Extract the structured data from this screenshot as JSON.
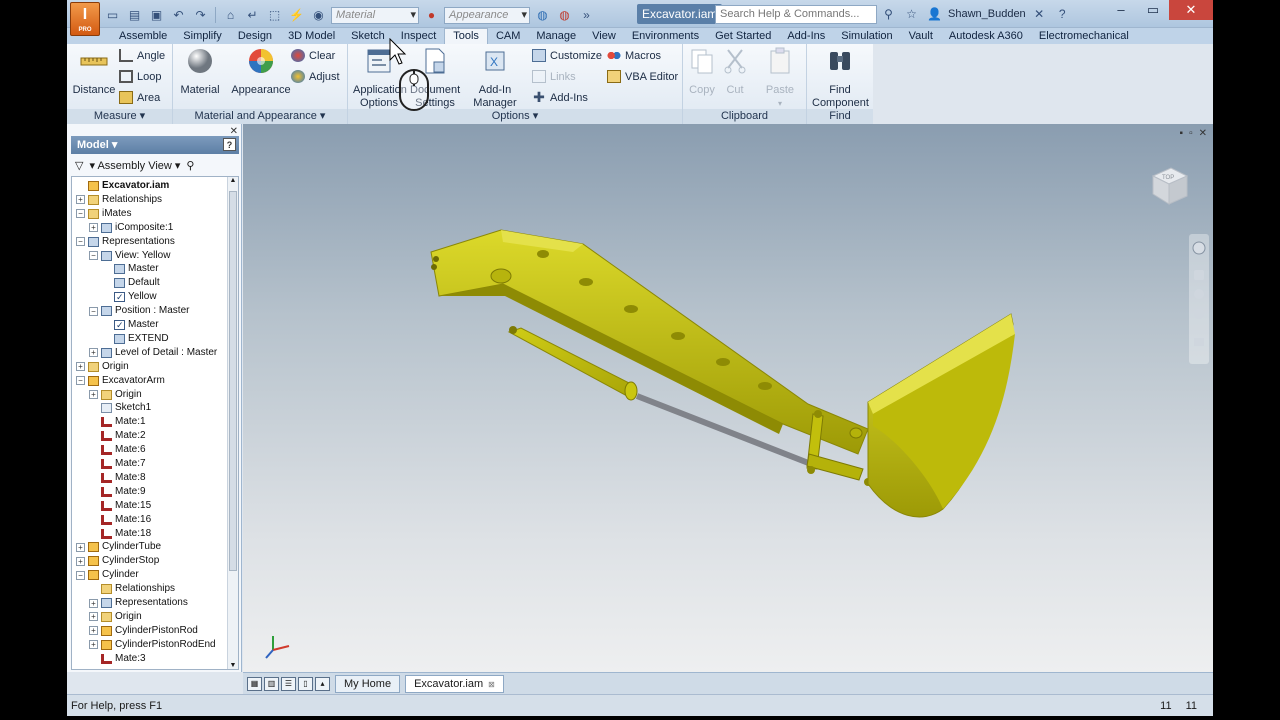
{
  "app": {
    "logo_text": "I",
    "logo_sub": "PRO",
    "document_title": "Excavator.iam",
    "search_placeholder": "Search Help & Commands...",
    "user_name": "Shawn_Budden",
    "material_combo": "Material",
    "appearance_combo": "Appearance"
  },
  "tabs": [
    "Assemble",
    "Simplify",
    "Design",
    "3D Model",
    "Sketch",
    "Inspect",
    "Tools",
    "CAM",
    "Manage",
    "View",
    "Environments",
    "Get Started",
    "Add-Ins",
    "Simulation",
    "Vault",
    "Autodesk A360",
    "Electromechanical"
  ],
  "active_tab": "Tools",
  "ribbon": {
    "measure": {
      "title": "Measure",
      "distance": "Distance",
      "angle": "Angle",
      "loop": "Loop",
      "area": "Area"
    },
    "material_appearance": {
      "title": "Material and Appearance",
      "material": "Material",
      "appearance": "Appearance",
      "clear": "Clear",
      "adjust": "Adjust"
    },
    "options": {
      "title": "Options",
      "application_options": "Application Options",
      "document_settings": "Document Settings",
      "addin_manager": "Add-In Manager",
      "customize": "Customize",
      "links": "Links",
      "addins": "Add-Ins",
      "macros": "Macros",
      "vba_editor": "VBA Editor"
    },
    "clipboard": {
      "title": "Clipboard",
      "copy": "Copy",
      "cut": "Cut",
      "paste": "Paste"
    },
    "find": {
      "title": "Find",
      "find_component": "Find Component"
    }
  },
  "browser": {
    "title": "Model",
    "view_selector": "Assembly View",
    "help": "?",
    "tree": [
      {
        "label": "Excavator.iam",
        "level": 0,
        "icon": "part",
        "exp": "",
        "bold": true
      },
      {
        "label": "Relationships",
        "level": 0,
        "icon": "folder",
        "exp": "+"
      },
      {
        "label": "iMates",
        "level": 0,
        "icon": "folder",
        "exp": "-"
      },
      {
        "label": "iComposite:1",
        "level": 1,
        "icon": "view",
        "exp": "+"
      },
      {
        "label": "Representations",
        "level": 0,
        "icon": "view",
        "exp": "-"
      },
      {
        "label": "View: Yellow",
        "level": 1,
        "icon": "view",
        "exp": "-"
      },
      {
        "label": "Master",
        "level": 2,
        "icon": "view",
        "exp": ""
      },
      {
        "label": "Default",
        "level": 2,
        "icon": "view",
        "exp": ""
      },
      {
        "label": "Yellow",
        "level": 2,
        "icon": "check",
        "exp": ""
      },
      {
        "label": "Position : Master",
        "level": 1,
        "icon": "view",
        "exp": "-"
      },
      {
        "label": "Master",
        "level": 2,
        "icon": "check",
        "exp": ""
      },
      {
        "label": "EXTEND",
        "level": 2,
        "icon": "view",
        "exp": ""
      },
      {
        "label": "Level of Detail : Master",
        "level": 1,
        "icon": "view",
        "exp": "+"
      },
      {
        "label": "Origin",
        "level": 0,
        "icon": "folder",
        "exp": "+"
      },
      {
        "label": "ExcavatorArm",
        "level": 0,
        "icon": "part",
        "exp": "-"
      },
      {
        "label": "Origin",
        "level": 1,
        "icon": "folder",
        "exp": "+"
      },
      {
        "label": "Sketch1",
        "level": 1,
        "icon": "sketch",
        "exp": ""
      },
      {
        "label": "Mate:1",
        "level": 1,
        "icon": "mate",
        "exp": ""
      },
      {
        "label": "Mate:2",
        "level": 1,
        "icon": "mate",
        "exp": ""
      },
      {
        "label": "Mate:6",
        "level": 1,
        "icon": "mate",
        "exp": ""
      },
      {
        "label": "Mate:7",
        "level": 1,
        "icon": "mate",
        "exp": ""
      },
      {
        "label": "Mate:8",
        "level": 1,
        "icon": "mate",
        "exp": ""
      },
      {
        "label": "Mate:9",
        "level": 1,
        "icon": "mate",
        "exp": ""
      },
      {
        "label": "Mate:15",
        "level": 1,
        "icon": "mate",
        "exp": ""
      },
      {
        "label": "Mate:16",
        "level": 1,
        "icon": "mate",
        "exp": ""
      },
      {
        "label": "Mate:18",
        "level": 1,
        "icon": "mate",
        "exp": ""
      },
      {
        "label": "CylinderTube",
        "level": 0,
        "icon": "part",
        "exp": "+"
      },
      {
        "label": "CylinderStop",
        "level": 0,
        "icon": "part",
        "exp": "+"
      },
      {
        "label": "Cylinder",
        "level": 0,
        "icon": "part",
        "exp": "-"
      },
      {
        "label": "Relationships",
        "level": 1,
        "icon": "folder",
        "exp": ""
      },
      {
        "label": "Representations",
        "level": 1,
        "icon": "view",
        "exp": "+"
      },
      {
        "label": "Origin",
        "level": 1,
        "icon": "folder",
        "exp": "+"
      },
      {
        "label": "CylinderPistonRod",
        "level": 1,
        "icon": "part",
        "exp": "+"
      },
      {
        "label": "CylinderPistonRodEnd",
        "level": 1,
        "icon": "part",
        "exp": "+"
      },
      {
        "label": "Mate:3",
        "level": 1,
        "icon": "mate",
        "exp": ""
      }
    ]
  },
  "viewcube_label": "TOP",
  "document_tabs": [
    "My Home",
    "Excavator.iam"
  ],
  "active_document_tab": "Excavator.iam",
  "status": {
    "help_text": "For Help, press F1",
    "count_a": "11",
    "count_b": "11"
  },
  "colors": {
    "model_yellow": "#c8c40a",
    "rod_gray": "#7d8087",
    "accent": "#5d7fa5"
  }
}
